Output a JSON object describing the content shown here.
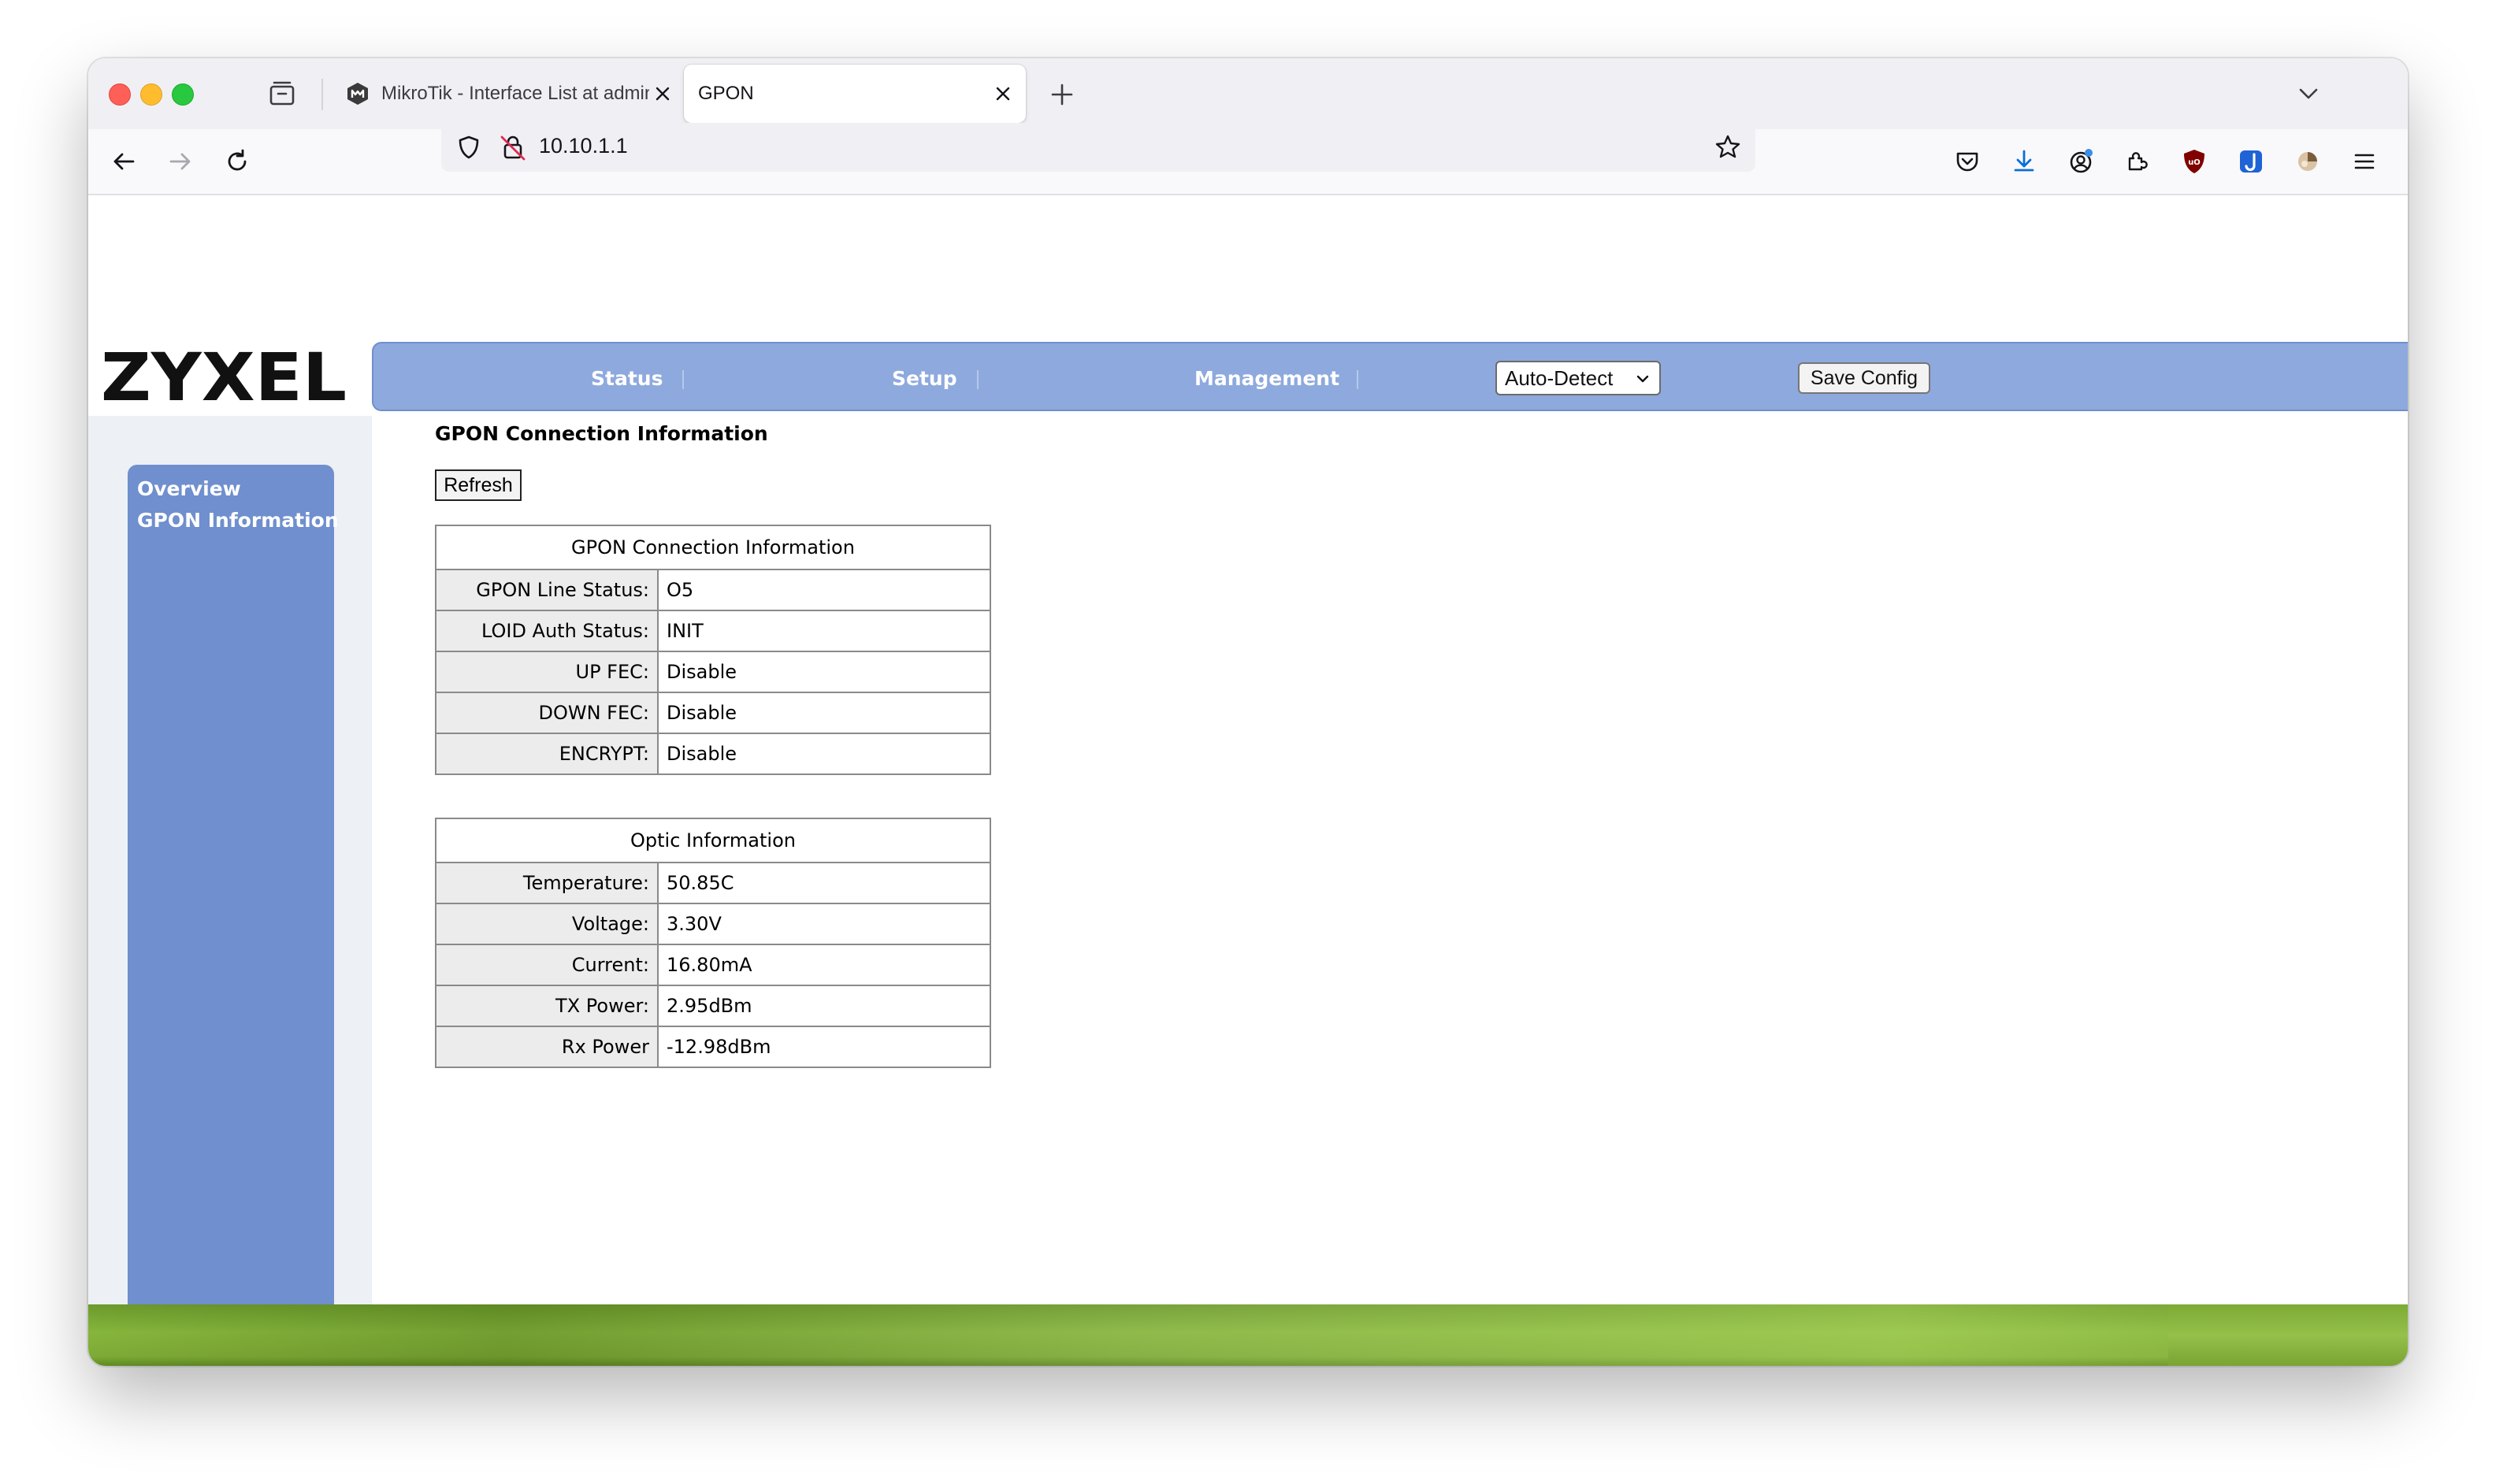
{
  "browser": {
    "tabs": [
      {
        "label": "MikroTik - Interface List at admin",
        "active": false,
        "favicon": "mikrotik-icon"
      },
      {
        "label": "GPON",
        "active": true
      }
    ],
    "url": "10.10.1.1"
  },
  "nav": {
    "status": "Status",
    "setup": "Setup",
    "management": "Management",
    "language_selected": "Auto-Detect",
    "save_config": "Save Config"
  },
  "sidebar": {
    "items": [
      "Overview",
      "GPON Information"
    ]
  },
  "main": {
    "heading": "GPON Connection Information",
    "refresh": "Refresh",
    "gpon_table": {
      "title": "GPON Connection Information",
      "rows": [
        {
          "label": "GPON Line Status:",
          "value": "O5"
        },
        {
          "label": "LOID Auth Status:",
          "value": "INIT"
        },
        {
          "label": "UP FEC:",
          "value": "Disable"
        },
        {
          "label": "DOWN FEC:",
          "value": "Disable"
        },
        {
          "label": "ENCRYPT:",
          "value": "Disable"
        }
      ]
    },
    "optic_table": {
      "title": "Optic Information",
      "rows": [
        {
          "label": "Temperature:",
          "value": "50.85C"
        },
        {
          "label": "Voltage:",
          "value": "3.30V"
        },
        {
          "label": "Current:",
          "value": "16.80mA"
        },
        {
          "label": "TX Power:",
          "value": "2.95dBm"
        },
        {
          "label": "Rx Power",
          "value": "-12.98dBm"
        }
      ]
    }
  },
  "brand": {
    "logo_text": "ZYXEL",
    "nav_color": "#8ea9dd",
    "sidebar_color": "#6f8fce",
    "footer_color": "#86b53c"
  }
}
